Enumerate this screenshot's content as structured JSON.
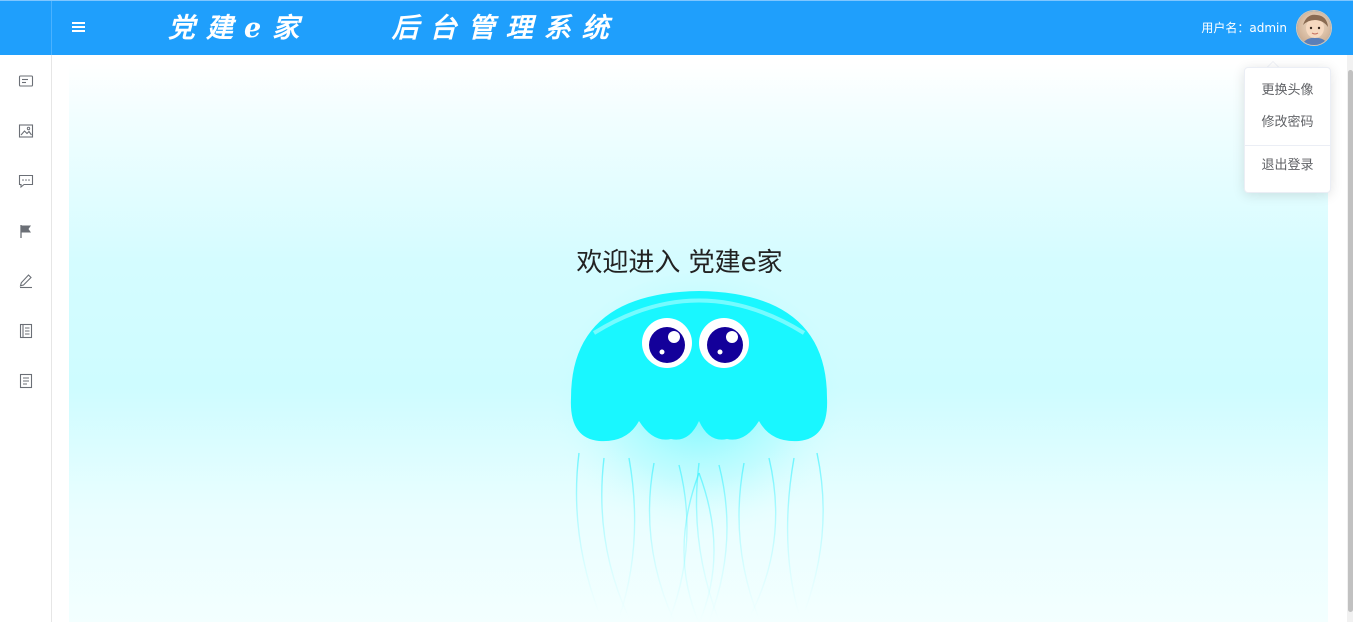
{
  "header": {
    "title": "党建e家    后台管理系统",
    "user_label": "用户名：admin",
    "menu_icon": "hamburger-icon",
    "avatar_icon": "user-avatar"
  },
  "sidebar": {
    "items": [
      {
        "icon": "card-icon"
      },
      {
        "icon": "picture-icon"
      },
      {
        "icon": "message-icon"
      },
      {
        "icon": "flag-icon"
      },
      {
        "icon": "edit-icon"
      },
      {
        "icon": "notebook-icon"
      },
      {
        "icon": "document-icon"
      }
    ]
  },
  "main": {
    "welcome_text": "欢迎进入 党建e家"
  },
  "dropdown": {
    "items": [
      {
        "label": "更换头像"
      },
      {
        "label": "修改密码"
      },
      {
        "label": "退出登录"
      }
    ]
  },
  "colors": {
    "header_bg": "#1f9ffc",
    "jellyfish_body": "#19f7ff",
    "eye_pupil": "#13009a"
  }
}
